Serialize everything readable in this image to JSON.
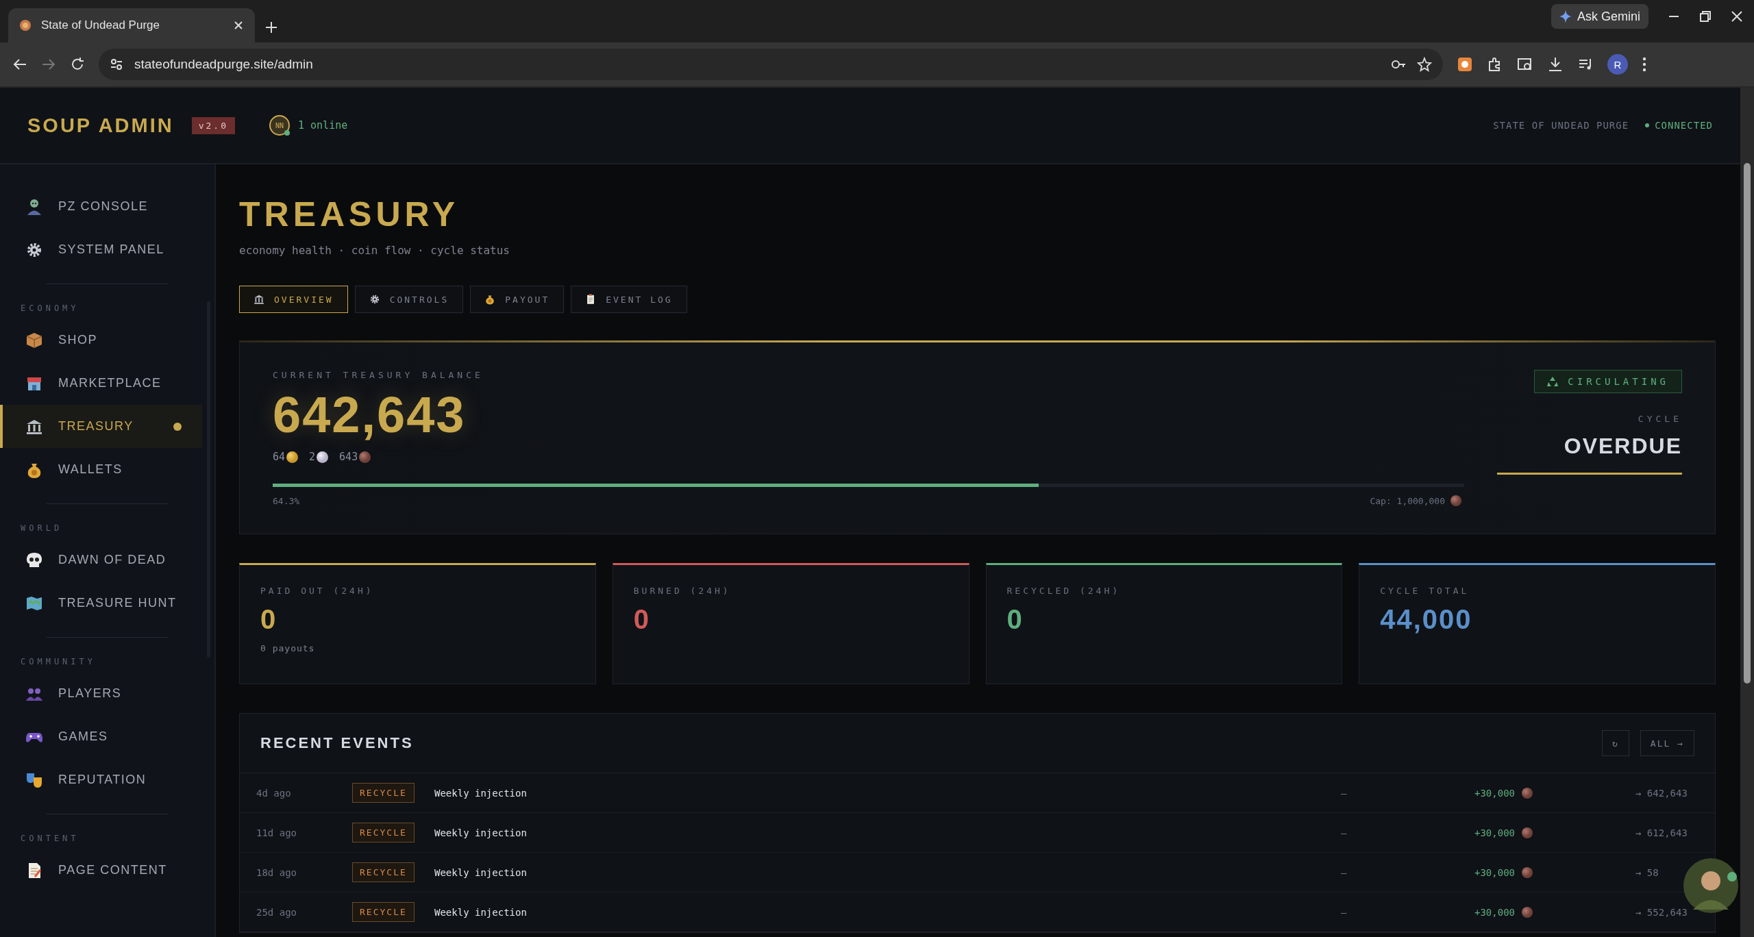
{
  "browser": {
    "tab_title": "State of Undead Purge",
    "url": "stateofundeadpurge.site/admin",
    "gemini_button": "Ask Gemini",
    "profile_initial": "R"
  },
  "header": {
    "logo": "SOUP ADMIN",
    "version": "v2.0",
    "avatar_initials": "NN",
    "online": "1 online",
    "server_name": "STATE OF UNDEAD PURGE",
    "status": "CONNECTED"
  },
  "sidebar": {
    "sections": [
      {
        "items": [
          {
            "label": "PZ CONSOLE",
            "selected": false
          },
          {
            "label": "SYSTEM PANEL",
            "selected": false
          }
        ]
      },
      {
        "heading": "ECONOMY",
        "items": [
          {
            "label": "SHOP",
            "selected": false
          },
          {
            "label": "MARKETPLACE",
            "selected": false
          },
          {
            "label": "TREASURY",
            "selected": true
          },
          {
            "label": "WALLETS",
            "selected": false
          }
        ]
      },
      {
        "heading": "WORLD",
        "items": [
          {
            "label": "DAWN OF DEAD",
            "selected": false
          },
          {
            "label": "TREASURE HUNT",
            "selected": false
          }
        ]
      },
      {
        "heading": "COMMUNITY",
        "items": [
          {
            "label": "PLAYERS",
            "selected": false
          },
          {
            "label": "GAMES",
            "selected": false
          },
          {
            "label": "REPUTATION",
            "selected": false
          }
        ]
      },
      {
        "heading": "CONTENT",
        "items": [
          {
            "label": "PAGE CONTENT",
            "selected": false
          }
        ]
      }
    ]
  },
  "page": {
    "title": "TREASURY",
    "subtitle": "economy health · coin flow · cycle status",
    "tabs": [
      {
        "label": "OVERVIEW",
        "selected": true
      },
      {
        "label": "CONTROLS",
        "selected": false
      },
      {
        "label": "PAYOUT",
        "selected": false
      },
      {
        "label": "EVENT LOG",
        "selected": false
      }
    ],
    "balance": {
      "label": "CURRENT TREASURY BALANCE",
      "amount": "642,643",
      "coins": [
        {
          "amount": "64",
          "kind": "gold"
        },
        {
          "amount": "2",
          "kind": "silver"
        },
        {
          "amount": "643",
          "kind": "copper"
        }
      ],
      "level": 0.643,
      "percent": "64.3%",
      "cap": "Cap: 1,000,000",
      "status": "CIRCULATING",
      "cycle_label": "CYCLE",
      "cycle_value": "OVERDUE"
    },
    "stats": [
      {
        "label": "PAID OUT (24H)",
        "value": "0",
        "note": "0 payouts",
        "color": "#c9a94f"
      },
      {
        "label": "BURNED (24H)",
        "value": "0",
        "color": "#d05a5a"
      },
      {
        "label": "RECYCLED (24H)",
        "value": "0",
        "color": "#5fae7e"
      },
      {
        "label": "CYCLE TOTAL",
        "value": "44,000",
        "color": "#5b8fc9"
      }
    ],
    "events": {
      "title": "RECENT EVENTS",
      "refresh_button": "↻",
      "all_button": "ALL →",
      "rows": [
        {
          "time": "4d ago",
          "type": "RECYCLE",
          "description": "Weekly injection",
          "source": "—",
          "amount": "+30,000",
          "balance": "→ 642,643"
        },
        {
          "time": "11d ago",
          "type": "RECYCLE",
          "description": "Weekly injection",
          "source": "—",
          "amount": "+30,000",
          "balance": "→ 612,643"
        },
        {
          "time": "18d ago",
          "type": "RECYCLE",
          "description": "Weekly injection",
          "source": "—",
          "amount": "+30,000",
          "balance": "→ 58"
        },
        {
          "time": "25d ago",
          "type": "RECYCLE",
          "description": "Weekly injection",
          "source": "—",
          "amount": "+30,000",
          "balance": "→ 552,643"
        }
      ]
    }
  }
}
